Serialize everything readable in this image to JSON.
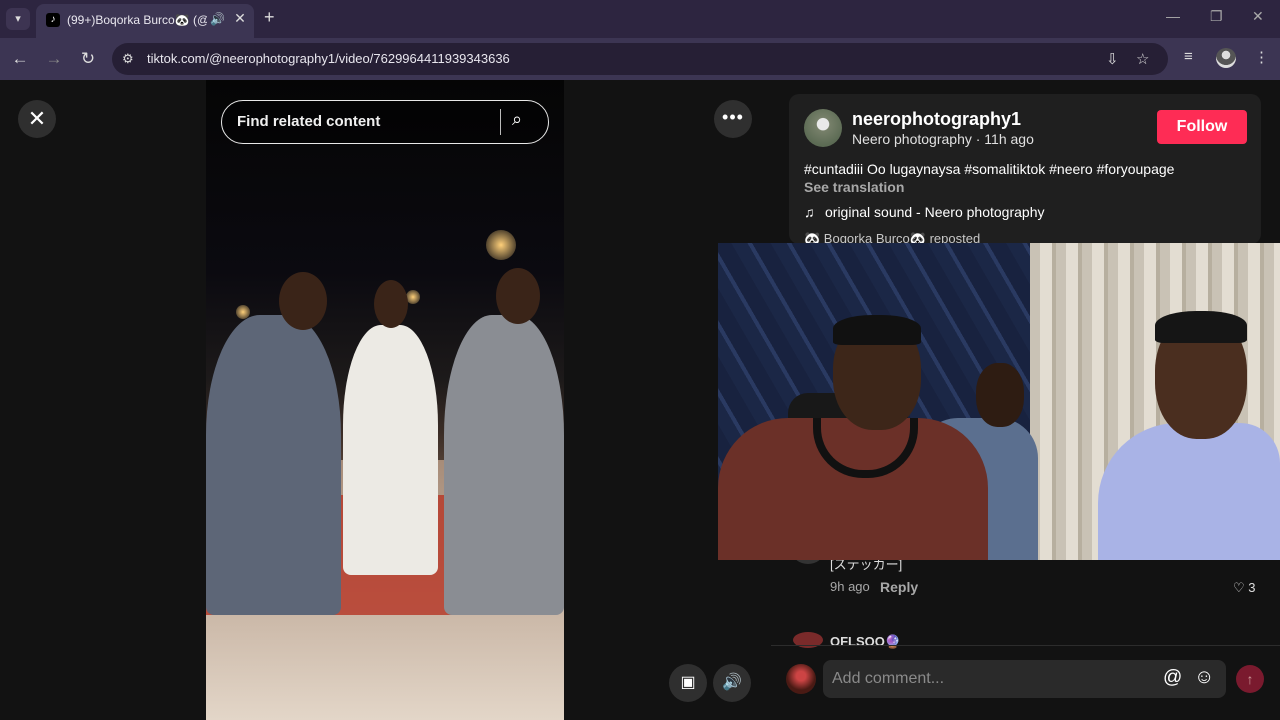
{
  "browser": {
    "tab_title": "(99+)Boqorka Burco🐼 (@",
    "new_tab_label": "+",
    "url": "tiktok.com/@neerophotography1/video/7629964411939343636",
    "window_controls": [
      "minimize-icon",
      "restore-icon",
      "close-icon"
    ]
  },
  "video_view": {
    "search_placeholder": "Find related content",
    "close_glyph": "✕",
    "more_glyph": "•••"
  },
  "post": {
    "username": "neerophotography1",
    "display_line": "Neero photography · 11h ago",
    "follow_label": "Follow",
    "caption": "#cuntadiii Oo lugaynaysa #somalitiktok #neero #foryoupage",
    "see_translation": "See translation",
    "music": "original sound - Neero photography",
    "repost_line": "🐼 Boqorka Burco🐼  reposted"
  },
  "comments": {
    "items": [
      {
        "text": "[ステッカー]",
        "time": "9h ago",
        "reply_label": "Reply",
        "likes": "3"
      },
      {
        "name": "OFLSOO🔮"
      }
    ],
    "input_placeholder": "Add comment...",
    "at_glyph": "@",
    "emoji_glyph": "☺"
  },
  "colors": {
    "accent_follow": "#fe2c55",
    "browser_frame": "#3c3553",
    "page_bg": "#121212"
  }
}
